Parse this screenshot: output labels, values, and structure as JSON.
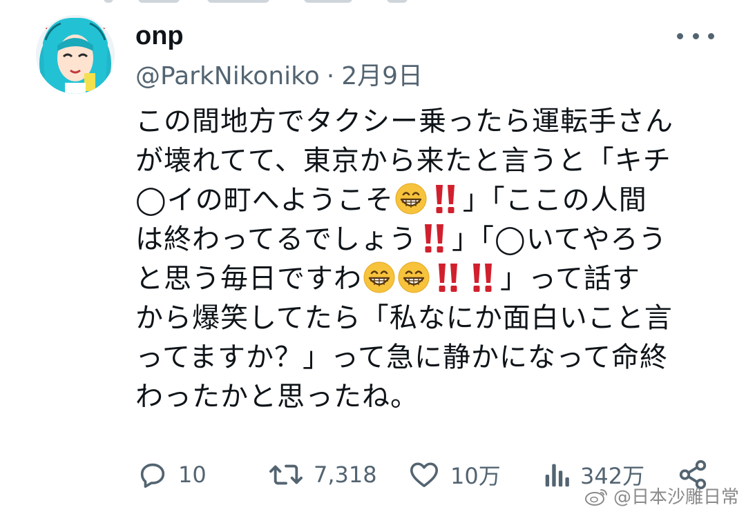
{
  "tweet": {
    "display_name": "onp",
    "handle": "@ParkNikoniko",
    "separator": "·",
    "date": "2月9日",
    "lines": [
      {
        "text": "この間地方でタクシー乗ったら運転手さん"
      },
      {
        "text": "が壊れてて、東京から来たと言うと「キチ"
      },
      {
        "a": "◯イの町へようこそ",
        "b": "」「ここの人間"
      },
      {
        "a": "は終わってるでしょう",
        "b": "」「◯いてやろう"
      },
      {
        "a": "と思う毎日ですわ",
        "b": "」って話す"
      },
      {
        "text": "から爆笑してたら「私なにか面白いこと言"
      },
      {
        "text": "ってますか？」って急に静かになって命終"
      },
      {
        "text": "わったかと思ったね。"
      }
    ],
    "emoji": {
      "grin": "grinning-face-emoji",
      "bang": "double-exclamation-emoji"
    }
  },
  "actions": {
    "replies": "10",
    "retweets": "7,318",
    "likes": "10万",
    "views": "342万"
  },
  "watermark": {
    "text": "@日本沙雕日常"
  },
  "colors": {
    "text": "#0f1419",
    "secondary": "#536471",
    "emoji_yellow": "#f7c33c",
    "exclamation_red": "#d1202d"
  },
  "icons": {
    "more": "more-icon",
    "reply": "reply-icon",
    "retweet": "retweet-icon",
    "like": "heart-icon",
    "views": "views-chart-icon",
    "share": "share-icon",
    "weibo": "weibo-logo-icon"
  }
}
